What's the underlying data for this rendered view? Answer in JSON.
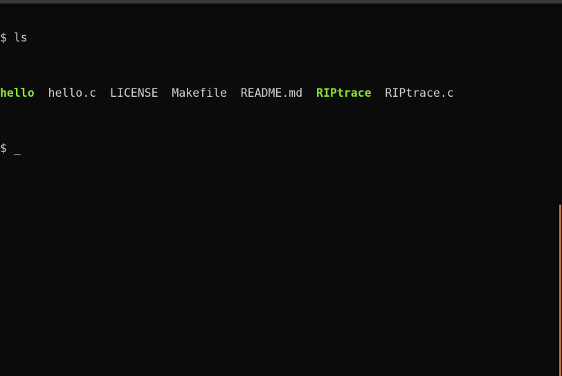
{
  "terminal": {
    "prompt_symbol": "$",
    "lines": [
      {
        "prompt": "$",
        "command": "ls"
      },
      {
        "prompt": "$",
        "cursor": "_"
      }
    ],
    "ls_output": [
      {
        "name": "hello",
        "executable": true
      },
      {
        "name": "hello.c",
        "executable": false
      },
      {
        "name": "LICENSE",
        "executable": false
      },
      {
        "name": "Makefile",
        "executable": false
      },
      {
        "name": "README.md",
        "executable": false
      },
      {
        "name": "RIPtrace",
        "executable": true
      },
      {
        "name": "RIPtrace.c",
        "executable": false
      }
    ],
    "colors": {
      "background": "#0b0b0b",
      "foreground": "#d0d0d0",
      "executable": "#8ae234",
      "scrollbar": "#c36a3a"
    }
  }
}
